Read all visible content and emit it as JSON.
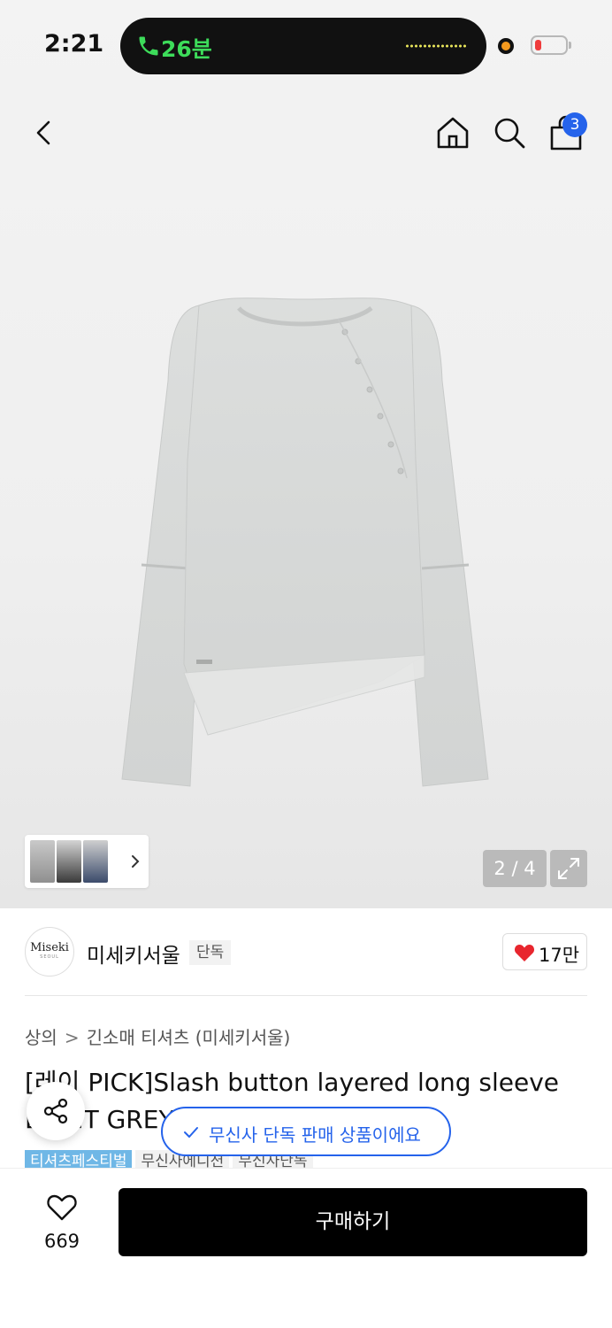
{
  "status": {
    "time": "2:21",
    "call_label": "26분",
    "colors": {
      "call": "#3ddc5a",
      "battery_low": "#ef3b3b",
      "recording": "#f59a1e"
    }
  },
  "nav": {
    "cart_count": "3",
    "icons": [
      "back-chevron-icon",
      "home-icon",
      "search-icon",
      "shopping-bag-icon"
    ]
  },
  "gallery": {
    "counter": "2 / 4",
    "current": 2,
    "total": 4
  },
  "brand": {
    "logo_text": "Miseki",
    "logo_sub": "SEOUL",
    "name": "미세키서울",
    "tag": "단독",
    "like_count": "17만"
  },
  "product": {
    "breadcrumb": [
      "상의",
      "긴소매 티셔츠 (미세키서울)"
    ],
    "title": "[레이 PICK]Slash button layered long sleeve LIGHT GREY",
    "chips": [
      {
        "label": "티셔츠페스티벌",
        "style": "blue"
      },
      {
        "label": "무신사에디션",
        "style": "gray"
      },
      {
        "label": "무신사단독",
        "style": "gray"
      }
    ],
    "exclusive_notice": "무신사 단독 판매 상품이에요"
  },
  "bottom": {
    "wish_count": "669",
    "buy_label": "구매하기"
  },
  "colors": {
    "accent": "#2563eb",
    "chip_blue": "#6fb7e6",
    "heart": "#e8262e"
  }
}
